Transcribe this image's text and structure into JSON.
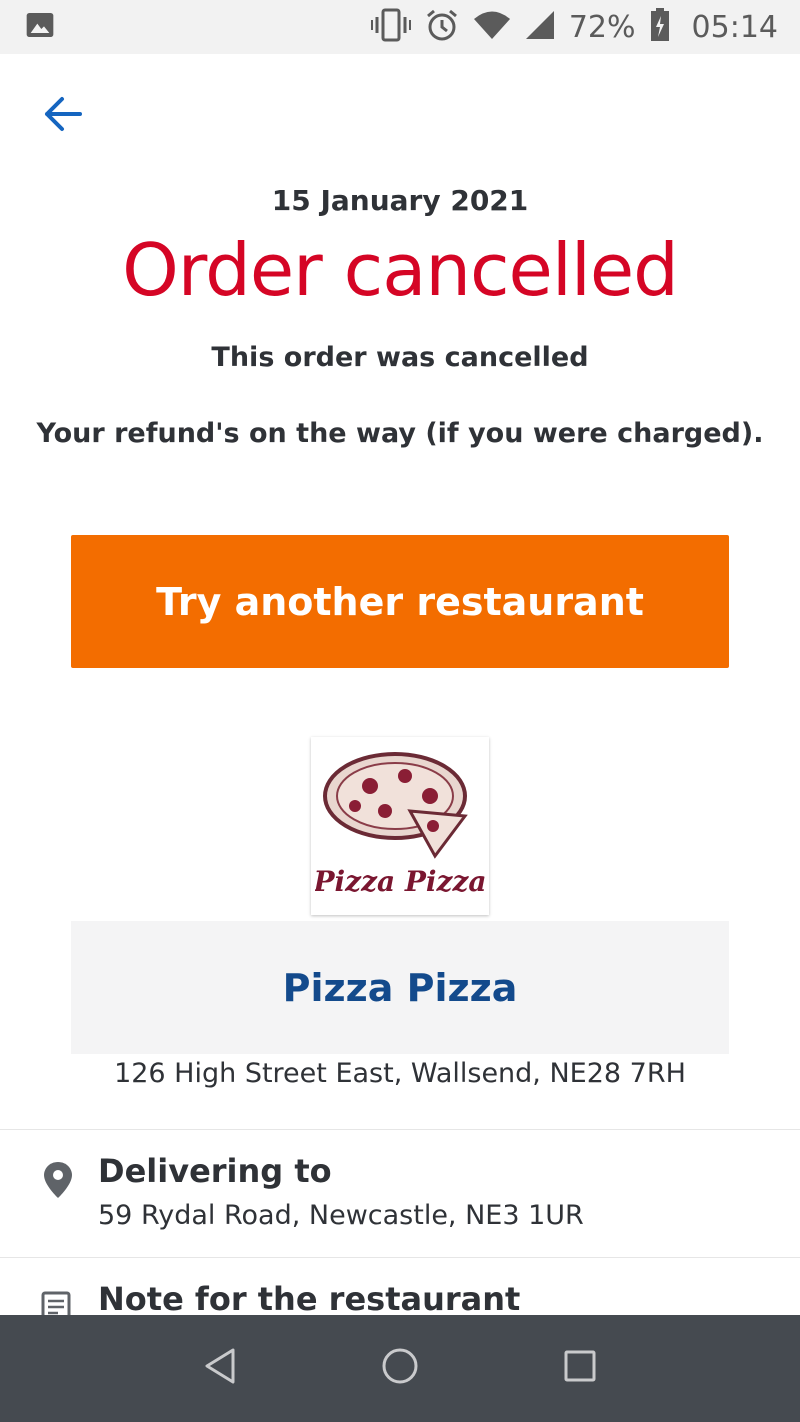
{
  "status_bar": {
    "battery": "72%",
    "time": "05:14",
    "icons": [
      "image-icon",
      "vibrate-icon",
      "alarm-icon",
      "wifi-icon",
      "signal-icon",
      "battery-charging-icon"
    ]
  },
  "header": {
    "back_icon": "arrow-left-icon"
  },
  "order": {
    "date": "15 January 2021",
    "status": "Order cancelled",
    "message": "This order was cancelled",
    "refund_message": "Your refund's on the way (if you were charged)."
  },
  "actions": {
    "try_another_label": "Try another restaurant"
  },
  "restaurant": {
    "logo_text": "Pizza Pizza",
    "name": "Pizza Pizza",
    "address": "126 High Street East, Wallsend, NE28 7RH"
  },
  "delivery": {
    "title": "Delivering to",
    "address": "59 Rydal Road, Newcastle, NE3 1UR",
    "icon": "location-pin-icon"
  },
  "note": {
    "title": "Note for the restaurant",
    "icon": "note-icon"
  },
  "nav_bar": {
    "buttons": [
      "back-triangle-icon",
      "home-circle-icon",
      "recents-square-icon"
    ]
  },
  "colors": {
    "status_red": "#d50525",
    "cta_orange": "#f36d00",
    "link_blue": "#134a8c",
    "back_arrow_blue": "#1565c0",
    "nav_bar": "#454a50"
  }
}
